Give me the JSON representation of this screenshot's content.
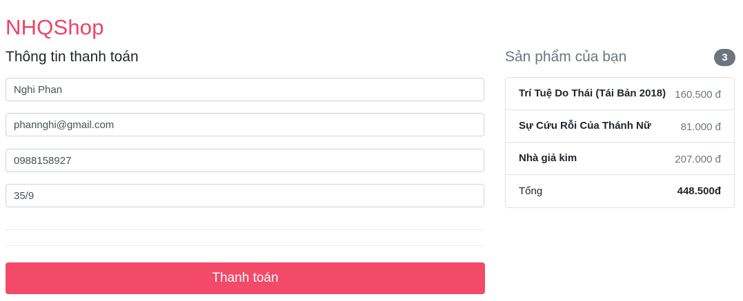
{
  "brand": {
    "name": "NHQShop",
    "color": "#ee4266"
  },
  "billing": {
    "title": "Thông tin thanh toán",
    "fields": {
      "name": "Nghi Phan",
      "email": "phannghi@gmail.com",
      "phone": "0988158927",
      "address": "35/9"
    },
    "submit_label": "Thanh toán",
    "submit_color": "#f24a68"
  },
  "cart": {
    "title": "Sản phẩm của bạn",
    "count": "3",
    "items": [
      {
        "name": "Trí Tuệ Do Thái (Tái Bản 2018)",
        "price": "160.500 đ"
      },
      {
        "name": "Sự Cứu Rỗi Của Thánh Nữ",
        "price": "81.000 đ"
      },
      {
        "name": "Nhà giả kim",
        "price": "207.000 đ"
      }
    ],
    "total_label": "Tổng",
    "total_value": "448.500đ"
  }
}
